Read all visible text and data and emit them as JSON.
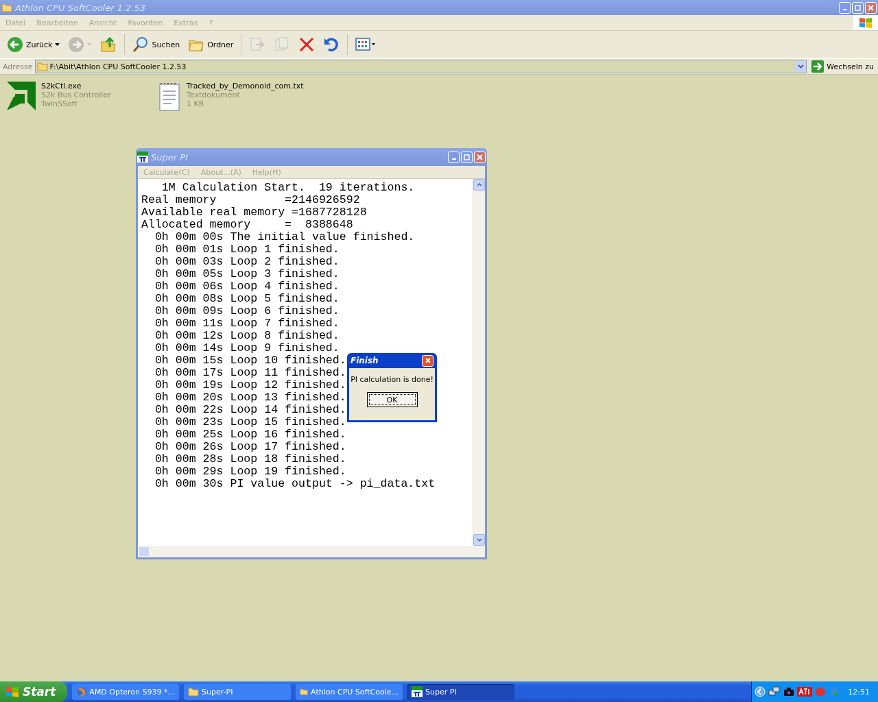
{
  "explorer": {
    "title": "Athlon CPU SoftCooler 1.2.53",
    "menu": [
      "Datei",
      "Bearbeiten",
      "Ansicht",
      "Favoriten",
      "Extras",
      "?"
    ],
    "toolbar": [
      {
        "kind": "back",
        "label": "Zurück",
        "disabled": false
      },
      {
        "kind": "forward",
        "disabled": true
      },
      {
        "kind": "up",
        "disabled": false
      },
      {
        "kind": "search",
        "label": "Suchen",
        "disabled": false
      },
      {
        "kind": "folders",
        "label": "Ordner",
        "disabled": false
      },
      {
        "kind": "move",
        "disabled": true
      },
      {
        "kind": "copy",
        "disabled": true
      },
      {
        "kind": "delete",
        "disabled": false
      },
      {
        "kind": "undo",
        "disabled": false
      },
      {
        "kind": "views",
        "disabled": false
      }
    ],
    "address": {
      "label": "Adresse",
      "value": "F:\\Abit\\Athlon CPU SoftCooler 1.2.53",
      "go": "Wechseln zu"
    },
    "files": [
      {
        "kind": "exe",
        "name": "S2kCtl.exe",
        "description": "S2k Bus Controller",
        "detail": "TwinSSoft"
      },
      {
        "kind": "text",
        "name": "Tracked_by_Demonoid_com.txt",
        "description": "Textdokument",
        "detail": "1 KB"
      }
    ]
  },
  "superpi": {
    "title": "Super PI",
    "menu": [
      "Calculate(C)",
      "About...(A)",
      "Help(H)"
    ],
    "lines": [
      {
        "kind": "title",
        "text": "1M Calculation Start.  19 iterations."
      },
      {
        "kind": "info",
        "text": "Real memory          =2146926592"
      },
      {
        "kind": "info",
        "text": "Available real memory =1687728128"
      },
      {
        "kind": "info",
        "text": "Allocated memory     =  8388648"
      },
      {
        "kind": "log",
        "text": "0h 00m 00s The initial value finished."
      },
      {
        "kind": "log",
        "text": "0h 00m 01s Loop 1 finished."
      },
      {
        "kind": "log",
        "text": "0h 00m 03s Loop 2 finished."
      },
      {
        "kind": "log",
        "text": "0h 00m 05s Loop 3 finished."
      },
      {
        "kind": "log",
        "text": "0h 00m 06s Loop 4 finished."
      },
      {
        "kind": "log",
        "text": "0h 00m 08s Loop 5 finished."
      },
      {
        "kind": "log",
        "text": "0h 00m 09s Loop 6 finished."
      },
      {
        "kind": "log",
        "text": "0h 00m 11s Loop 7 finished."
      },
      {
        "kind": "log",
        "text": "0h 00m 12s Loop 8 finished."
      },
      {
        "kind": "log",
        "text": "0h 00m 14s Loop 9 finished."
      },
      {
        "kind": "log",
        "text": "0h 00m 15s Loop 10 finished."
      },
      {
        "kind": "log",
        "text": "0h 00m 17s Loop 11 finished."
      },
      {
        "kind": "log",
        "text": "0h 00m 19s Loop 12 finished."
      },
      {
        "kind": "log",
        "text": "0h 00m 20s Loop 13 finished."
      },
      {
        "kind": "log",
        "text": "0h 00m 22s Loop 14 finished."
      },
      {
        "kind": "log",
        "text": "0h 00m 23s Loop 15 finished."
      },
      {
        "kind": "log",
        "text": "0h 00m 25s Loop 16 finished."
      },
      {
        "kind": "log",
        "text": "0h 00m 26s Loop 17 finished."
      },
      {
        "kind": "log",
        "text": "0h 00m 28s Loop 18 finished."
      },
      {
        "kind": "log",
        "text": "0h 00m 29s Loop 19 finished."
      },
      {
        "kind": "log",
        "text": "0h 00m 30s PI value output -> pi_data.txt"
      }
    ]
  },
  "dialog": {
    "title": "Finish",
    "message": "PI calculation is done!",
    "button": "OK"
  },
  "taskbar": {
    "start": "Start",
    "tasks": [
      {
        "kind": "browser",
        "label": "AMD Opteron S939 *...",
        "selected": false
      },
      {
        "kind": "folder",
        "label": "Super-PI",
        "selected": false
      },
      {
        "kind": "folder",
        "label": "Athlon CPU SoftCoole...",
        "selected": false
      },
      {
        "kind": "superpi",
        "label": "Super PI",
        "selected": true
      }
    ],
    "clock": "12:51"
  }
}
